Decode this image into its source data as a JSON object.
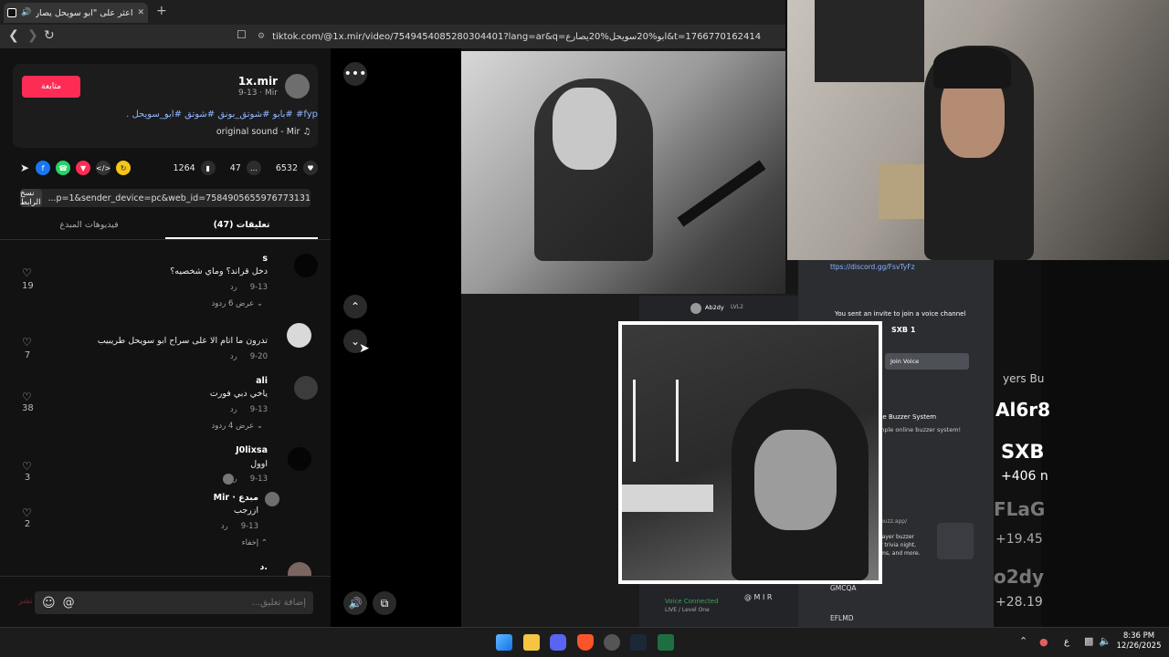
{
  "browser": {
    "tab_title": "اعثر على \"ابو سويحل يصارع\" على",
    "new_tab": "+",
    "tab_close": "✕",
    "url": "tiktok.com/@1x.mir/video/7549454085280304401?lang=ar&q=ابو%20سويحل%20يصارع&t=1766770162414"
  },
  "post": {
    "follow_label": "متابعة",
    "username": "1x.mir",
    "sub": "9-13 · Mir",
    "tags": "fyp# #بابو #شوتق_بونق #شوتق #ابو_سويحل .",
    "sound": "original sound - Mir",
    "likes": "6532",
    "comments_count": "47",
    "saves": "1264",
    "link": "...p=1&sender_device=pc&web_id=7584905655976773131",
    "copy_label": "نسخ الرابط"
  },
  "tabs": {
    "comments": "تعليقات (47)",
    "creator_videos": "فيديوهات المبدع"
  },
  "comments": [
    {
      "name": "s",
      "text": "دخل قراند؟ وماي شخصيه؟",
      "date": "9-13",
      "reply": "رد",
      "likes": "19",
      "more": "عرض 6 ردود"
    },
    {
      "name": "",
      "text": "تدرون ما اتام الا على سراح ابو سويحل طريبيب",
      "date": "9-20",
      "reply": "رد",
      "likes": "7",
      "more": ""
    },
    {
      "name": "ali",
      "text": "ياخي دبي فورت",
      "date": "9-13",
      "reply": "رد",
      "likes": "38",
      "more": "عرض 4 ردود"
    },
    {
      "name": "J0lixsa",
      "text": "اوول",
      "date": "9-13",
      "reply": "رد",
      "likes": "3",
      "more": ""
    },
    {
      "name": "Mir · مبدع",
      "text": "ازرجب",
      "date": "9-13",
      "reply": "رد",
      "likes": "2",
      "more": "إخفاء"
    },
    {
      "name": "د.",
      "text": "",
      "date": "",
      "reply": "",
      "likes": "",
      "more": ""
    }
  ],
  "composer": {
    "placeholder": "إضافة تعليق...",
    "at": "@",
    "post_label": "نشر"
  },
  "overlay": {
    "discord_url": "ttps://discord.gg/FsvTyFz",
    "invite_text": "You sent an invite to join a voice channel",
    "server_name": "SXB 1",
    "join_label": "Join Voice",
    "buzzer_title": "ne Buzzer System",
    "buzzer_desc": "mple online buzzer system!",
    "voice_connected": "Voice Connected",
    "gmcqa": "GMCQA",
    "eflmd": "EFLMD",
    "mir_watermark": "@ M I R",
    "side_top": "yers Bu",
    "side_1": "Al6r8",
    "side_2": "SXB",
    "side_3": "+406 n",
    "side_4": "FLaG",
    "side_5": "+19.45",
    "side_6": "o2dy",
    "side_7": "+28.19",
    "user_ab": "Ab2dy",
    "level_ab": "LVL2",
    "buzz_url": "buzz.app/",
    "buzz_desc_1": "layer buzzer",
    "buzz_desc_2": "r trivia night,",
    "buzz_desc_3": "ms, and more.",
    "vc_level": "LIVE / Level One",
    "time_label": "8:42 AM"
  },
  "taskbar": {
    "lang": "ع",
    "time": "8:36 PM",
    "date": "12/26/2025"
  }
}
